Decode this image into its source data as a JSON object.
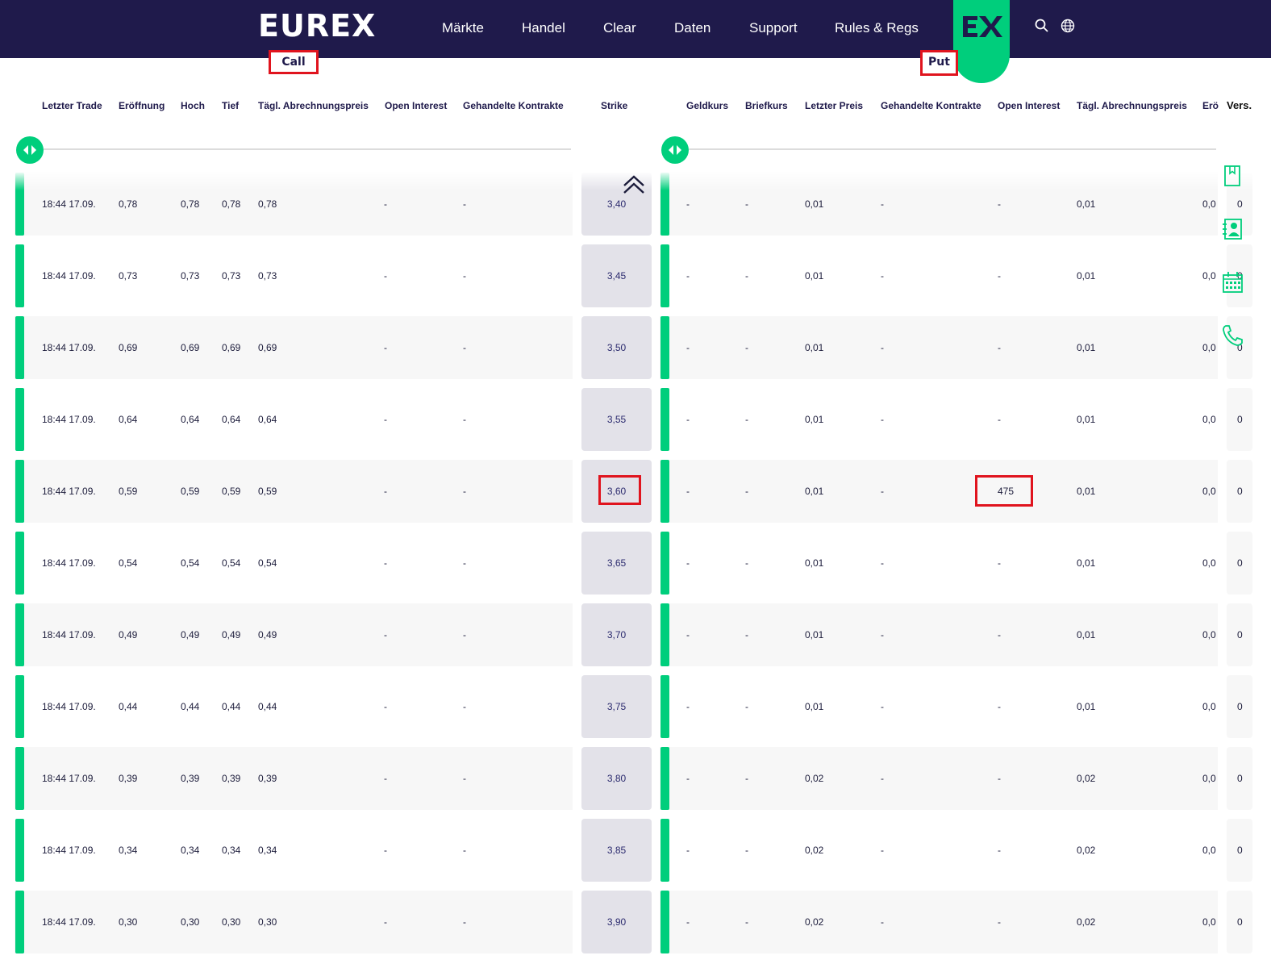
{
  "header": {
    "logo": "EUREX",
    "nav": [
      "Märkte",
      "Handel",
      "Clear",
      "Daten",
      "Support",
      "Rules & Regs"
    ],
    "ex_badge_icon": "ex-logo-icon",
    "icons": [
      "search-icon",
      "globe-icon"
    ]
  },
  "labels": {
    "call": "Call",
    "put": "Put"
  },
  "call_headers": [
    "Letzter Trade",
    "Eröffnung",
    "Hoch",
    "Tief",
    "Tägl. Abrechnungspreis",
    "Open Interest",
    "Gehandelte Kontrakte"
  ],
  "strike_header": "Strike",
  "put_headers": [
    "Geldkurs",
    "Briefkurs",
    "Letzter Preis",
    "Gehandelte Kontrakte",
    "Open Interest",
    "Tägl. Abrechnungspreis",
    "Erö",
    "Vers."
  ],
  "rows": [
    {
      "call": [
        "18:44 17.09.",
        "0,78",
        "0,78",
        "0,78",
        "0,78",
        "-",
        "-"
      ],
      "strike": "3,40",
      "put": [
        "-",
        "-",
        "0,01",
        "-",
        "-",
        "0,01",
        "0,0",
        "0"
      ]
    },
    {
      "call": [
        "18:44 17.09.",
        "0,73",
        "0,73",
        "0,73",
        "0,73",
        "-",
        "-"
      ],
      "strike": "3,45",
      "put": [
        "-",
        "-",
        "0,01",
        "-",
        "-",
        "0,01",
        "0,0",
        "0"
      ]
    },
    {
      "call": [
        "18:44 17.09.",
        "0,69",
        "0,69",
        "0,69",
        "0,69",
        "-",
        "-"
      ],
      "strike": "3,50",
      "put": [
        "-",
        "-",
        "0,01",
        "-",
        "-",
        "0,01",
        "0,0",
        "0"
      ]
    },
    {
      "call": [
        "18:44 17.09.",
        "0,64",
        "0,64",
        "0,64",
        "0,64",
        "-",
        "-"
      ],
      "strike": "3,55",
      "put": [
        "-",
        "-",
        "0,01",
        "-",
        "-",
        "0,01",
        "0,0",
        "0"
      ]
    },
    {
      "call": [
        "18:44 17.09.",
        "0,59",
        "0,59",
        "0,59",
        "0,59",
        "-",
        "-"
      ],
      "strike": "3,60",
      "put": [
        "-",
        "-",
        "0,01",
        "-",
        "475",
        "0,01",
        "0,0",
        "0"
      ]
    },
    {
      "call": [
        "18:44 17.09.",
        "0,54",
        "0,54",
        "0,54",
        "0,54",
        "-",
        "-"
      ],
      "strike": "3,65",
      "put": [
        "-",
        "-",
        "0,01",
        "-",
        "-",
        "0,01",
        "0,0",
        "0"
      ]
    },
    {
      "call": [
        "18:44 17.09.",
        "0,49",
        "0,49",
        "0,49",
        "0,49",
        "-",
        "-"
      ],
      "strike": "3,70",
      "put": [
        "-",
        "-",
        "0,01",
        "-",
        "-",
        "0,01",
        "0,0",
        "0"
      ]
    },
    {
      "call": [
        "18:44 17.09.",
        "0,44",
        "0,44",
        "0,44",
        "0,44",
        "-",
        "-"
      ],
      "strike": "3,75",
      "put": [
        "-",
        "-",
        "0,01",
        "-",
        "-",
        "0,01",
        "0,0",
        "0"
      ]
    },
    {
      "call": [
        "18:44 17.09.",
        "0,39",
        "0,39",
        "0,39",
        "0,39",
        "-",
        "-"
      ],
      "strike": "3,80",
      "put": [
        "-",
        "-",
        "0,02",
        "-",
        "-",
        "0,02",
        "0,0",
        "0"
      ]
    },
    {
      "call": [
        "18:44 17.09.",
        "0,34",
        "0,34",
        "0,34",
        "0,34",
        "-",
        "-"
      ],
      "strike": "3,85",
      "put": [
        "-",
        "-",
        "0,02",
        "-",
        "-",
        "0,02",
        "0,0",
        "0"
      ]
    },
    {
      "call": [
        "18:44 17.09.",
        "0,30",
        "0,30",
        "0,30",
        "0,30",
        "-",
        "-"
      ],
      "strike": "3,90",
      "put": [
        "-",
        "-",
        "0,02",
        "-",
        "-",
        "0,02",
        "0,0",
        "0"
      ]
    }
  ],
  "side_icons": [
    "bookmark-icon",
    "contact-card-icon",
    "calendar-icon",
    "phone-icon"
  ],
  "colors": {
    "navy": "#1f1a4b",
    "green": "#00ce7c",
    "highlight_red": "#e0141e",
    "strike_bg": "#e3e2e9"
  }
}
